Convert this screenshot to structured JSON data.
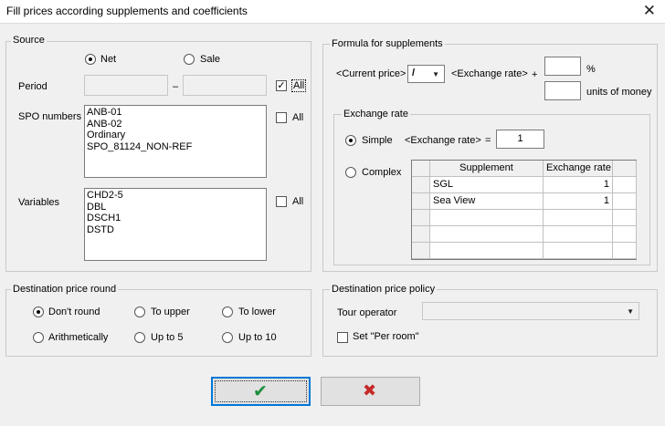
{
  "window": {
    "title": "Fill prices according supplements and coefficients",
    "close_glyph": "✕"
  },
  "source": {
    "legend": "Source",
    "net_label": "Net",
    "sale_label": "Sale",
    "selected": "Net",
    "period_label": "Period",
    "period_from": "",
    "period_dash": "–",
    "period_to": "",
    "period_all_label": "All",
    "period_all_checked": true,
    "spo_label": "SPO numbers",
    "spo_items": [
      "ANB-01",
      "ANB-02",
      "Ordinary",
      "SPO_81124_NON-REF"
    ],
    "spo_all_label": "All",
    "spo_all_checked": false,
    "variables_label": "Variables",
    "variables_items": [
      "CHD2-5",
      "DBL",
      "DSCH1",
      "DSTD"
    ],
    "variables_all_label": "All",
    "variables_all_checked": false
  },
  "formula": {
    "legend": "Formula for supplements",
    "current_price": "<Current price>",
    "operator": "/",
    "exchange_rate": "<Exchange rate>",
    "plus": "+",
    "percent_value": "",
    "percent_sign": "%",
    "money_value": "",
    "money_label": "units of money"
  },
  "exchange_rate": {
    "legend": "Exchange rate",
    "simple_label": "Simple",
    "complex_label": "Complex",
    "selected": "Simple",
    "simple_formula": "<Exchange rate>",
    "equals": "=",
    "simple_value": "1",
    "table": {
      "columns": [
        "Supplement",
        "Exchange rate"
      ],
      "rows": [
        [
          "SGL",
          "1"
        ],
        [
          "Sea View",
          "1"
        ],
        [
          "",
          ""
        ],
        [
          "",
          ""
        ],
        [
          "",
          ""
        ]
      ]
    }
  },
  "round": {
    "legend": "Destination price round",
    "options": [
      "Don't round",
      "To upper",
      "To lower",
      "Arithmetically",
      "Up to 5",
      "Up to 10"
    ],
    "selected": "Don't round"
  },
  "policy": {
    "legend": "Destination price policy",
    "tour_operator_label": "Tour operator",
    "tour_operator_value": "",
    "per_room_label": "Set \"Per room\"",
    "per_room_checked": false
  },
  "buttons": {
    "ok_glyph": "✔",
    "cancel_glyph": "✖",
    "ok_color": "#1e8e3e",
    "cancel_color": "#c62828"
  }
}
